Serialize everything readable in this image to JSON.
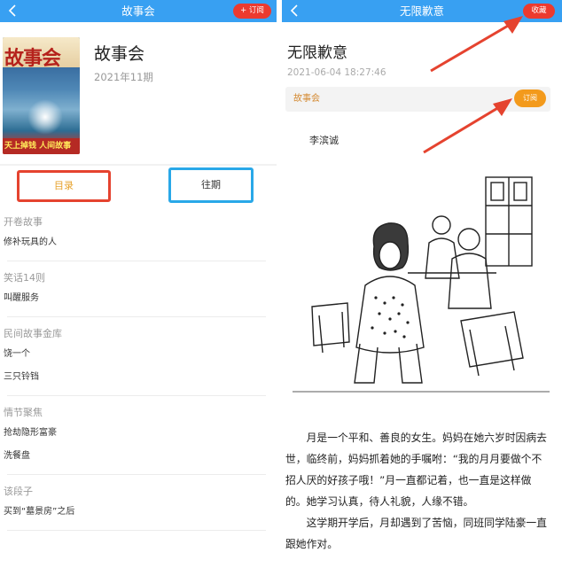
{
  "left": {
    "header": {
      "title": "故事会",
      "subscribe_label": "+ 订阅"
    },
    "magazine": {
      "name": "故事会",
      "issue": "2021年11期",
      "cover_title": "故事会",
      "cover_strip": "天上掉钱 人间故事"
    },
    "tabs": {
      "toc_label": "目录",
      "past_label": "往期"
    },
    "toc": [
      {
        "section": "开卷故事",
        "items": [
          "修补玩具的人"
        ]
      },
      {
        "section": "笑话14则",
        "items": [
          "叫醒服务"
        ]
      },
      {
        "section": "民间故事金库",
        "items": [
          "饶一个",
          "三只铃铛"
        ]
      },
      {
        "section": "情节聚焦",
        "items": [
          "抢劫隐形富豪",
          "洗餐盘"
        ]
      },
      {
        "section": "该段子",
        "items": [
          "买到“墓景房”之后"
        ]
      }
    ]
  },
  "right": {
    "header": {
      "title": "无限歉意",
      "favorite_label": "收藏"
    },
    "article": {
      "title": "无限歉意",
      "timestamp": "2021-06-04 18:27:46",
      "source": "故事会",
      "subscribe_label": "订阅",
      "author": "李滨诚",
      "paragraphs": [
        "月是一个平和、善良的女生。妈妈在她六岁时因病去世，临终前，妈妈抓着她的手嘱咐：“我的月月要做个不招人厌的好孩子哦！”月一直都记着，也一直是这样做的。她学习认真，待人礼貌，人缘不错。",
        "这学期开学后，月却遇到了苦恼，同班同学陆豪一直跟她作对。"
      ]
    }
  },
  "colors": {
    "header_blue": "#38a0f2",
    "red_button": "#ec3a2f",
    "orange_button": "#f39a1c",
    "source_text": "#d48a32",
    "toc_tab_text": "#e6a22c",
    "annotation_red": "#e5432f",
    "annotation_blue": "#29a8e8"
  }
}
